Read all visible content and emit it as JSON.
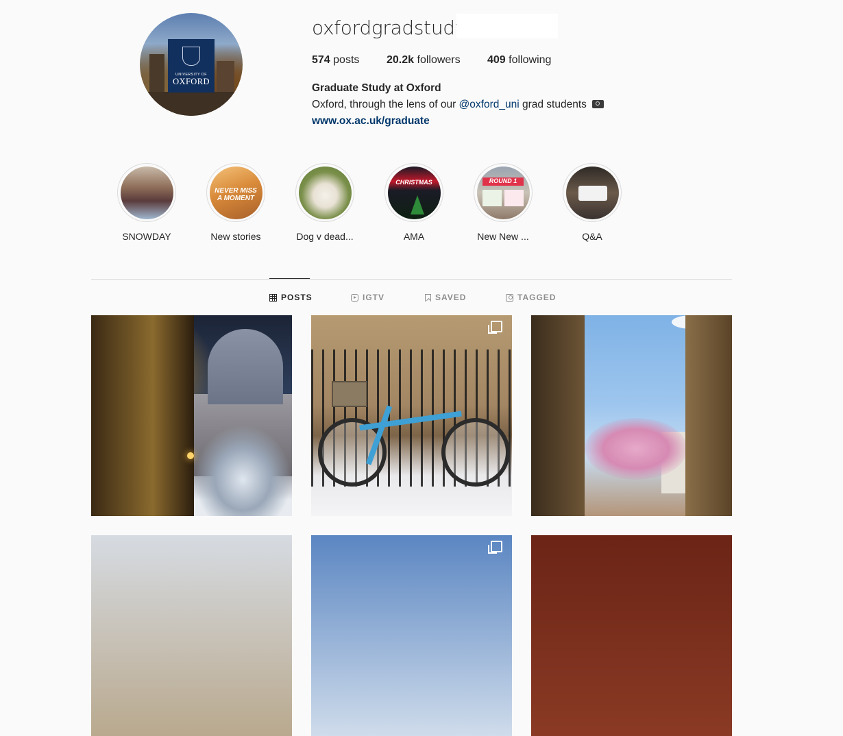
{
  "profile": {
    "username": "oxfordgradstudy",
    "stats": {
      "posts_count": "574",
      "posts_label": "posts",
      "followers_count": "20.2k",
      "followers_label": "followers",
      "following_count": "409",
      "following_label": "following"
    },
    "full_name": "Graduate Study at Oxford",
    "bio_prefix": "Oxford, through the lens of our ",
    "bio_mention": "@oxford_uni",
    "bio_suffix": " grad students",
    "bio_icon": "camera-icon",
    "website": "www.ox.ac.uk/graduate",
    "avatar_logo": {
      "line1": "UNIVERSITY OF",
      "line2": "OXFORD"
    }
  },
  "highlights": [
    {
      "label": "SNOWDAY",
      "cover_text": ""
    },
    {
      "label": "New stories",
      "cover_text": "NEVER MISS A MOMENT"
    },
    {
      "label": "Dog v dead...",
      "cover_text": ""
    },
    {
      "label": "AMA",
      "cover_text": "CHRISTMAS"
    },
    {
      "label": "New New ...",
      "cover_text": "ROUND 1"
    },
    {
      "label": "Q&A",
      "cover_text": ""
    }
  ],
  "tabs": [
    {
      "label": "POSTS",
      "icon": "grid-icon",
      "active": true
    },
    {
      "label": "IGTV",
      "icon": "igtv-icon",
      "active": false
    },
    {
      "label": "SAVED",
      "icon": "bookmark-icon",
      "active": false
    },
    {
      "label": "TAGGED",
      "icon": "tag-icon",
      "active": false
    }
  ],
  "colors": {
    "background": "#fafafa",
    "text": "#262626",
    "link": "#00376b",
    "muted": "#8e8e8e",
    "border": "#dbdbdb"
  }
}
